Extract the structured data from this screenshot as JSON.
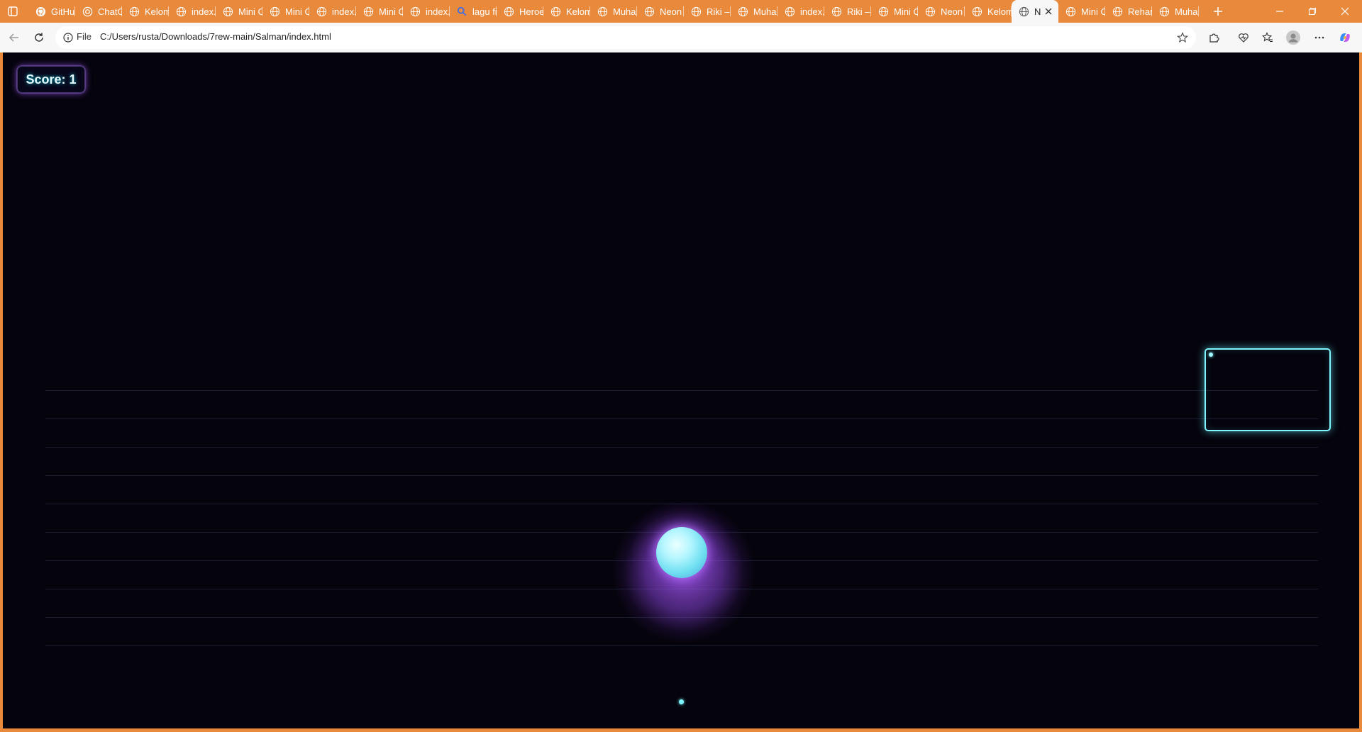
{
  "browser": {
    "tabs": [
      {
        "label": "GitHub",
        "icon": "github-icon"
      },
      {
        "label": "ChatGPT",
        "icon": "chatgpt-icon"
      },
      {
        "label": "Kelompok",
        "icon": "globe-icon"
      },
      {
        "label": "index.",
        "icon": "globe-icon"
      },
      {
        "label": "Mini C",
        "icon": "globe-icon"
      },
      {
        "label": "Mini C",
        "icon": "globe-icon"
      },
      {
        "label": "index.",
        "icon": "globe-icon"
      },
      {
        "label": "Mini C",
        "icon": "globe-icon"
      },
      {
        "label": "index.",
        "icon": "globe-icon"
      },
      {
        "label": "lagu fi",
        "icon": "search-icon"
      },
      {
        "label": "Heroe",
        "icon": "globe-icon"
      },
      {
        "label": "Kelom",
        "icon": "globe-icon"
      },
      {
        "label": "Muha",
        "icon": "globe-icon"
      },
      {
        "label": "Neon",
        "icon": "globe-icon"
      },
      {
        "label": "Riki –",
        "icon": "globe-icon"
      },
      {
        "label": "Muha",
        "icon": "globe-icon"
      },
      {
        "label": "index.",
        "icon": "globe-icon"
      },
      {
        "label": "Riki –",
        "icon": "globe-icon"
      },
      {
        "label": "Mini C",
        "icon": "globe-icon"
      },
      {
        "label": "Neon",
        "icon": "globe-icon"
      },
      {
        "label": "Kelom",
        "icon": "globe-icon"
      },
      {
        "label": "N",
        "icon": "globe-icon",
        "active": true
      },
      {
        "label": "Mini C",
        "icon": "globe-icon"
      },
      {
        "label": "Rehan",
        "icon": "globe-icon"
      },
      {
        "label": "Muha",
        "icon": "globe-icon"
      }
    ],
    "address": {
      "scheme": "File",
      "url": "C:/Users/rusta/Downloads/7rew-main/Salman/index.html"
    },
    "colors": {
      "frame": "#e8893c",
      "toolbar": "#f7f7f7"
    }
  },
  "game": {
    "score_label": "Score:",
    "score_value": "1",
    "colors": {
      "background": "#05030c",
      "accent_cyan": "#7ff6ff",
      "glow_purple": "#a05aff"
    }
  }
}
